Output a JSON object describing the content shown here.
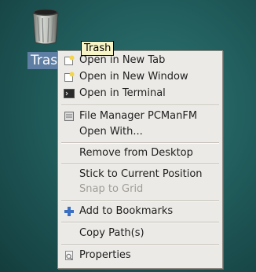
{
  "desktop": {
    "icon": {
      "name": "trash-icon",
      "label": "Trash"
    },
    "tooltip": "Trash"
  },
  "context_menu": {
    "items": [
      {
        "label": "Open in New Tab",
        "icon": "new-tab-icon",
        "enabled": true
      },
      {
        "label": "Open in New Window",
        "icon": "new-window-icon",
        "enabled": true
      },
      {
        "label": "Open in Terminal",
        "icon": "terminal-icon",
        "enabled": true
      },
      {
        "label": "File Manager PCManFM",
        "icon": "file-manager-icon",
        "enabled": true
      },
      {
        "label": "Open With...",
        "icon": "",
        "enabled": true
      },
      {
        "label": "Remove from Desktop",
        "icon": "",
        "enabled": true
      },
      {
        "label": "Stick to Current Position",
        "icon": "",
        "enabled": true
      },
      {
        "label": "Snap to Grid",
        "icon": "",
        "enabled": false
      },
      {
        "label": "Add to Bookmarks",
        "icon": "add-icon",
        "enabled": true
      },
      {
        "label": "Copy Path(s)",
        "icon": "",
        "enabled": true
      },
      {
        "label": "Properties",
        "icon": "properties-icon",
        "enabled": true
      }
    ]
  }
}
